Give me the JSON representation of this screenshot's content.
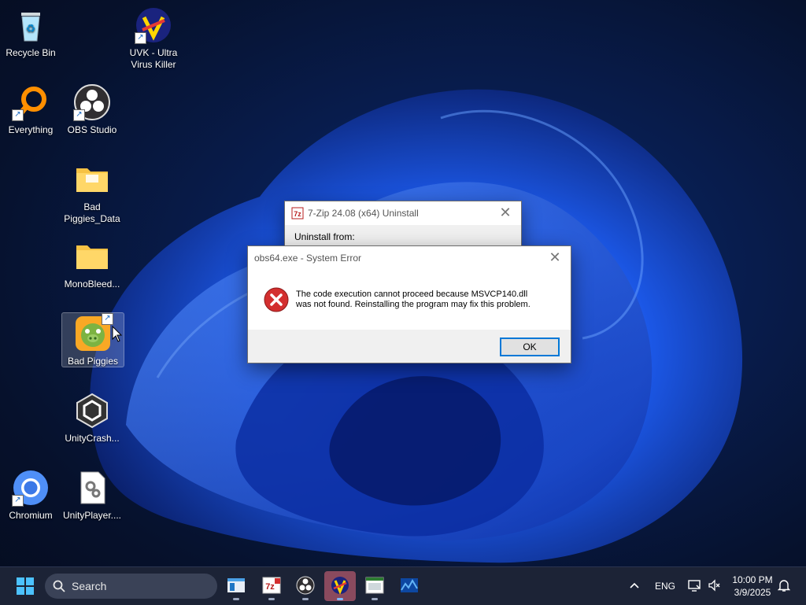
{
  "desktop_icons": [
    {
      "label": "Recycle Bin"
    },
    {
      "label": "UVK - Ultra Virus Killer"
    },
    {
      "label": "Everything"
    },
    {
      "label": "OBS Studio"
    },
    {
      "label": "Bad Piggies_Data"
    },
    {
      "label": "MonoBleed..."
    },
    {
      "label": "Bad Piggies"
    },
    {
      "label": "UnityCrash..."
    },
    {
      "label": "Chromium"
    },
    {
      "label": "UnityPlayer...."
    }
  ],
  "uninstall_dialog": {
    "title": "7-Zip 24.08 (x64) Uninstall",
    "label": "Uninstall from:"
  },
  "error_dialog": {
    "title": "obs64.exe - System Error",
    "message_line1": "The code execution cannot proceed because MSVCP140.dll",
    "message_line2": "was not found. Reinstalling the program may fix this problem.",
    "ok_label": "OK"
  },
  "taskbar": {
    "search_label": "Search",
    "language": "ENG",
    "time": "10:00 PM",
    "date": "3/9/2025"
  },
  "colors": {
    "accent": "#0078d7",
    "error_red": "#d32f2f",
    "taskbar_bg": "#1c2336"
  }
}
